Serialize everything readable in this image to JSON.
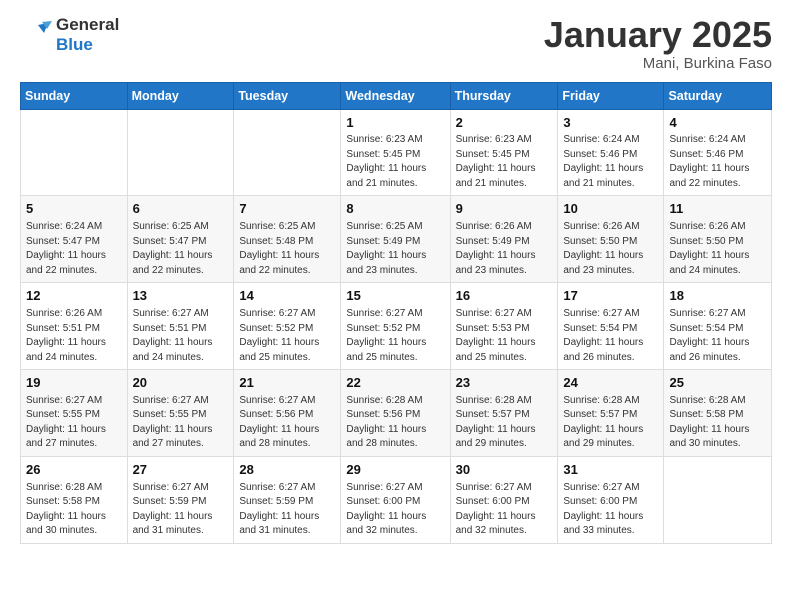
{
  "header": {
    "logo_line1": "General",
    "logo_line2": "Blue",
    "month": "January 2025",
    "location": "Mani, Burkina Faso"
  },
  "weekdays": [
    "Sunday",
    "Monday",
    "Tuesday",
    "Wednesday",
    "Thursday",
    "Friday",
    "Saturday"
  ],
  "weeks": [
    [
      {
        "day": "",
        "info": ""
      },
      {
        "day": "",
        "info": ""
      },
      {
        "day": "",
        "info": ""
      },
      {
        "day": "1",
        "info": "Sunrise: 6:23 AM\nSunset: 5:45 PM\nDaylight: 11 hours\nand 21 minutes."
      },
      {
        "day": "2",
        "info": "Sunrise: 6:23 AM\nSunset: 5:45 PM\nDaylight: 11 hours\nand 21 minutes."
      },
      {
        "day": "3",
        "info": "Sunrise: 6:24 AM\nSunset: 5:46 PM\nDaylight: 11 hours\nand 21 minutes."
      },
      {
        "day": "4",
        "info": "Sunrise: 6:24 AM\nSunset: 5:46 PM\nDaylight: 11 hours\nand 22 minutes."
      }
    ],
    [
      {
        "day": "5",
        "info": "Sunrise: 6:24 AM\nSunset: 5:47 PM\nDaylight: 11 hours\nand 22 minutes."
      },
      {
        "day": "6",
        "info": "Sunrise: 6:25 AM\nSunset: 5:47 PM\nDaylight: 11 hours\nand 22 minutes."
      },
      {
        "day": "7",
        "info": "Sunrise: 6:25 AM\nSunset: 5:48 PM\nDaylight: 11 hours\nand 22 minutes."
      },
      {
        "day": "8",
        "info": "Sunrise: 6:25 AM\nSunset: 5:49 PM\nDaylight: 11 hours\nand 23 minutes."
      },
      {
        "day": "9",
        "info": "Sunrise: 6:26 AM\nSunset: 5:49 PM\nDaylight: 11 hours\nand 23 minutes."
      },
      {
        "day": "10",
        "info": "Sunrise: 6:26 AM\nSunset: 5:50 PM\nDaylight: 11 hours\nand 23 minutes."
      },
      {
        "day": "11",
        "info": "Sunrise: 6:26 AM\nSunset: 5:50 PM\nDaylight: 11 hours\nand 24 minutes."
      }
    ],
    [
      {
        "day": "12",
        "info": "Sunrise: 6:26 AM\nSunset: 5:51 PM\nDaylight: 11 hours\nand 24 minutes."
      },
      {
        "day": "13",
        "info": "Sunrise: 6:27 AM\nSunset: 5:51 PM\nDaylight: 11 hours\nand 24 minutes."
      },
      {
        "day": "14",
        "info": "Sunrise: 6:27 AM\nSunset: 5:52 PM\nDaylight: 11 hours\nand 25 minutes."
      },
      {
        "day": "15",
        "info": "Sunrise: 6:27 AM\nSunset: 5:52 PM\nDaylight: 11 hours\nand 25 minutes."
      },
      {
        "day": "16",
        "info": "Sunrise: 6:27 AM\nSunset: 5:53 PM\nDaylight: 11 hours\nand 25 minutes."
      },
      {
        "day": "17",
        "info": "Sunrise: 6:27 AM\nSunset: 5:54 PM\nDaylight: 11 hours\nand 26 minutes."
      },
      {
        "day": "18",
        "info": "Sunrise: 6:27 AM\nSunset: 5:54 PM\nDaylight: 11 hours\nand 26 minutes."
      }
    ],
    [
      {
        "day": "19",
        "info": "Sunrise: 6:27 AM\nSunset: 5:55 PM\nDaylight: 11 hours\nand 27 minutes."
      },
      {
        "day": "20",
        "info": "Sunrise: 6:27 AM\nSunset: 5:55 PM\nDaylight: 11 hours\nand 27 minutes."
      },
      {
        "day": "21",
        "info": "Sunrise: 6:27 AM\nSunset: 5:56 PM\nDaylight: 11 hours\nand 28 minutes."
      },
      {
        "day": "22",
        "info": "Sunrise: 6:28 AM\nSunset: 5:56 PM\nDaylight: 11 hours\nand 28 minutes."
      },
      {
        "day": "23",
        "info": "Sunrise: 6:28 AM\nSunset: 5:57 PM\nDaylight: 11 hours\nand 29 minutes."
      },
      {
        "day": "24",
        "info": "Sunrise: 6:28 AM\nSunset: 5:57 PM\nDaylight: 11 hours\nand 29 minutes."
      },
      {
        "day": "25",
        "info": "Sunrise: 6:28 AM\nSunset: 5:58 PM\nDaylight: 11 hours\nand 30 minutes."
      }
    ],
    [
      {
        "day": "26",
        "info": "Sunrise: 6:28 AM\nSunset: 5:58 PM\nDaylight: 11 hours\nand 30 minutes."
      },
      {
        "day": "27",
        "info": "Sunrise: 6:27 AM\nSunset: 5:59 PM\nDaylight: 11 hours\nand 31 minutes."
      },
      {
        "day": "28",
        "info": "Sunrise: 6:27 AM\nSunset: 5:59 PM\nDaylight: 11 hours\nand 31 minutes."
      },
      {
        "day": "29",
        "info": "Sunrise: 6:27 AM\nSunset: 6:00 PM\nDaylight: 11 hours\nand 32 minutes."
      },
      {
        "day": "30",
        "info": "Sunrise: 6:27 AM\nSunset: 6:00 PM\nDaylight: 11 hours\nand 32 minutes."
      },
      {
        "day": "31",
        "info": "Sunrise: 6:27 AM\nSunset: 6:00 PM\nDaylight: 11 hours\nand 33 minutes."
      },
      {
        "day": "",
        "info": ""
      }
    ]
  ]
}
